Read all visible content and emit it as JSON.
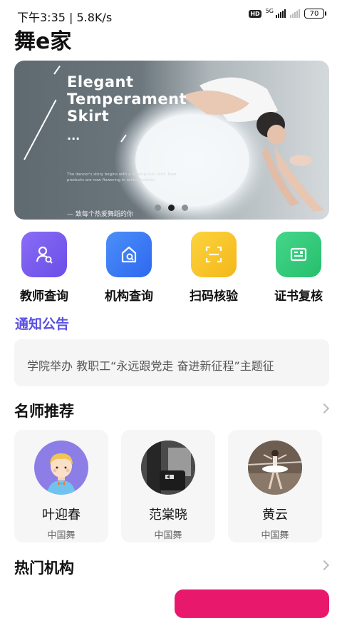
{
  "status_bar": {
    "time": "下午3:35 | 5.8K/s",
    "hd": "HD",
    "network": "5G",
    "battery": "70"
  },
  "app": {
    "title": "舞e家"
  },
  "banner": {
    "headline_lines": [
      "Elegant",
      "Temperament",
      "Skirt"
    ],
    "ellipsis": "...",
    "small_text": "The dancer's story begins with a flowing tutu skirt. New products are now flowering in winter fashion.",
    "tagline": "— 致每个热爱舞蹈的你",
    "pager": {
      "count": 3,
      "active_index": 1
    }
  },
  "quick_actions": [
    {
      "label": "教师查询",
      "icon": "teacher-search-icon",
      "color": "#7b5cf0"
    },
    {
      "label": "机构查询",
      "icon": "institution-search-icon",
      "color": "#3d7ef5"
    },
    {
      "label": "扫码核验",
      "icon": "scan-code-icon",
      "color": "#f6c027"
    },
    {
      "label": "证书复核",
      "icon": "certificate-icon",
      "color": "#33c97c"
    }
  ],
  "notice": {
    "title": "通知公告",
    "text": "学院举办 教职工“永远跟党走 奋进新征程”主题征"
  },
  "teachers": {
    "title": "名师推荐",
    "items": [
      {
        "name": "叶迎春",
        "category": "中国舞"
      },
      {
        "name": "范棠晓",
        "category": "中国舞"
      },
      {
        "name": "黄云",
        "category": "中国舞"
      }
    ]
  },
  "institutions": {
    "title": "热门机构"
  },
  "colors": {
    "accent": "#5a4fe0",
    "pink": "#e8186d"
  }
}
